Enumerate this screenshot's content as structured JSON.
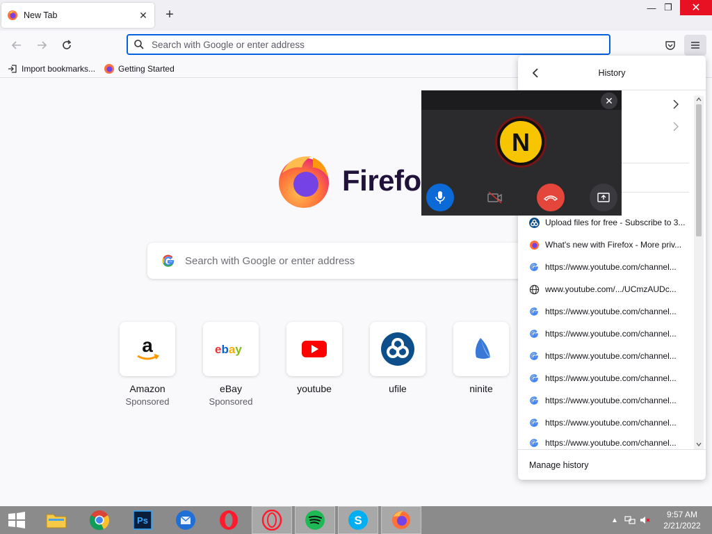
{
  "browser": {
    "tab": {
      "title": "New Tab"
    },
    "url_bar": {
      "placeholder": "Search with Google or enter address"
    },
    "bookmarks": [
      {
        "label": "Import bookmarks...",
        "icon": "import-icon"
      },
      {
        "label": "Getting Started",
        "icon": "firefox-icon"
      }
    ]
  },
  "newtab": {
    "brand": "Firefox",
    "search_placeholder": "Search with Google or enter address",
    "top_sites": [
      {
        "name": "Amazon",
        "sub": "Sponsored",
        "icon": "amazon-icon"
      },
      {
        "name": "eBay",
        "sub": "Sponsored",
        "icon": "ebay-icon"
      },
      {
        "name": "youtube",
        "sub": "",
        "icon": "youtube-icon"
      },
      {
        "name": "ufile",
        "sub": "",
        "icon": "ufile-icon"
      },
      {
        "name": "ninite",
        "sub": "",
        "icon": "ninite-icon"
      }
    ]
  },
  "history_panel": {
    "title": "History",
    "items": [
      {
        "title": "Upload files for free - Subscribe to 3...",
        "icon": "ufile-icon"
      },
      {
        "title": "What's new with Firefox - More priv...",
        "icon": "firefox-icon"
      },
      {
        "title": "https://www.youtube.com/channel...",
        "icon": "google-icon"
      },
      {
        "title": "www.youtube.com/.../UCmzAUDc...",
        "icon": "globe-icon"
      },
      {
        "title": "https://www.youtube.com/channel...",
        "icon": "google-icon"
      },
      {
        "title": "https://www.youtube.com/channel...",
        "icon": "google-icon"
      },
      {
        "title": "https://www.youtube.com/channel...",
        "icon": "google-icon"
      },
      {
        "title": "https://www.youtube.com/channel...",
        "icon": "google-icon"
      },
      {
        "title": "https://www.youtube.com/channel...",
        "icon": "google-icon"
      },
      {
        "title": "https://www.youtube.com/channel...",
        "icon": "google-icon"
      },
      {
        "title": "https://www.youtube.com/channel...",
        "icon": "google-icon"
      }
    ],
    "footer": "Manage history"
  },
  "call_overlay": {
    "avatar_letter": "N"
  },
  "taskbar": {
    "apps": [
      "start",
      "file-explorer",
      "chrome",
      "photoshop",
      "thunderbird",
      "opera",
      "opera-gx",
      "spotify",
      "skype",
      "firefox"
    ],
    "time": "9:57 AM",
    "date": "2/21/2022"
  },
  "colors": {
    "accent": "#0061e0",
    "end_call": "#e5463b",
    "mic": "#0b6ad6",
    "close": "#e81123"
  }
}
